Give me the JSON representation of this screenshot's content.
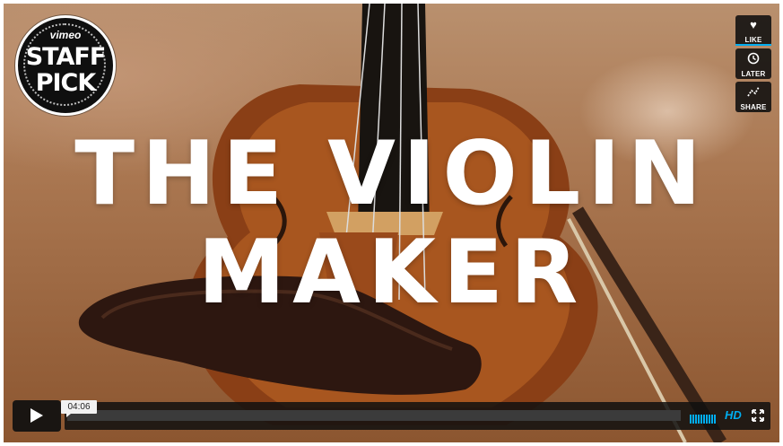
{
  "video": {
    "title": "THE VIOLIN MAKER",
    "duration": "04:06",
    "quality_label": "HD"
  },
  "badge": {
    "brand": "vimeo",
    "line1": "STAFF",
    "line2": "PICK"
  },
  "sidebar": {
    "like_label": "LIKE",
    "later_label": "LATER",
    "share_label": "SHARE"
  },
  "colors": {
    "accent": "#00adef",
    "overlay": "#0f0f0f",
    "wood": "#a97650"
  },
  "icons": [
    "heart-icon",
    "clock-icon",
    "share-icon",
    "play-icon",
    "volume-icon",
    "fullscreen-icon"
  ]
}
